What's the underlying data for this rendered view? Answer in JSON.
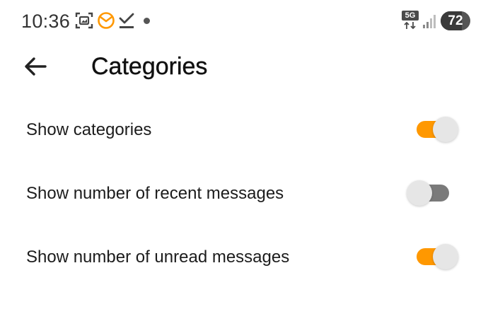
{
  "status_bar": {
    "time": "10:36",
    "network": "5G",
    "battery_level": "72",
    "battery_fraction": 0.72,
    "icons": [
      "screenshot-icon",
      "mail-app-icon",
      "download-done-icon",
      "notification-dot-icon",
      "5g-icon",
      "signal-icon",
      "battery-icon"
    ]
  },
  "toolbar": {
    "title": "Categories",
    "back_icon": "arrow-left-icon"
  },
  "settings": [
    {
      "label": "Show categories",
      "enabled": true
    },
    {
      "label": "Show number of recent messages",
      "enabled": false
    },
    {
      "label": "Show number of unread messages",
      "enabled": true
    }
  ],
  "colors": {
    "accent": "#ff9800",
    "track_off": "#7a7a7a",
    "thumb": "#e6e6e6"
  }
}
